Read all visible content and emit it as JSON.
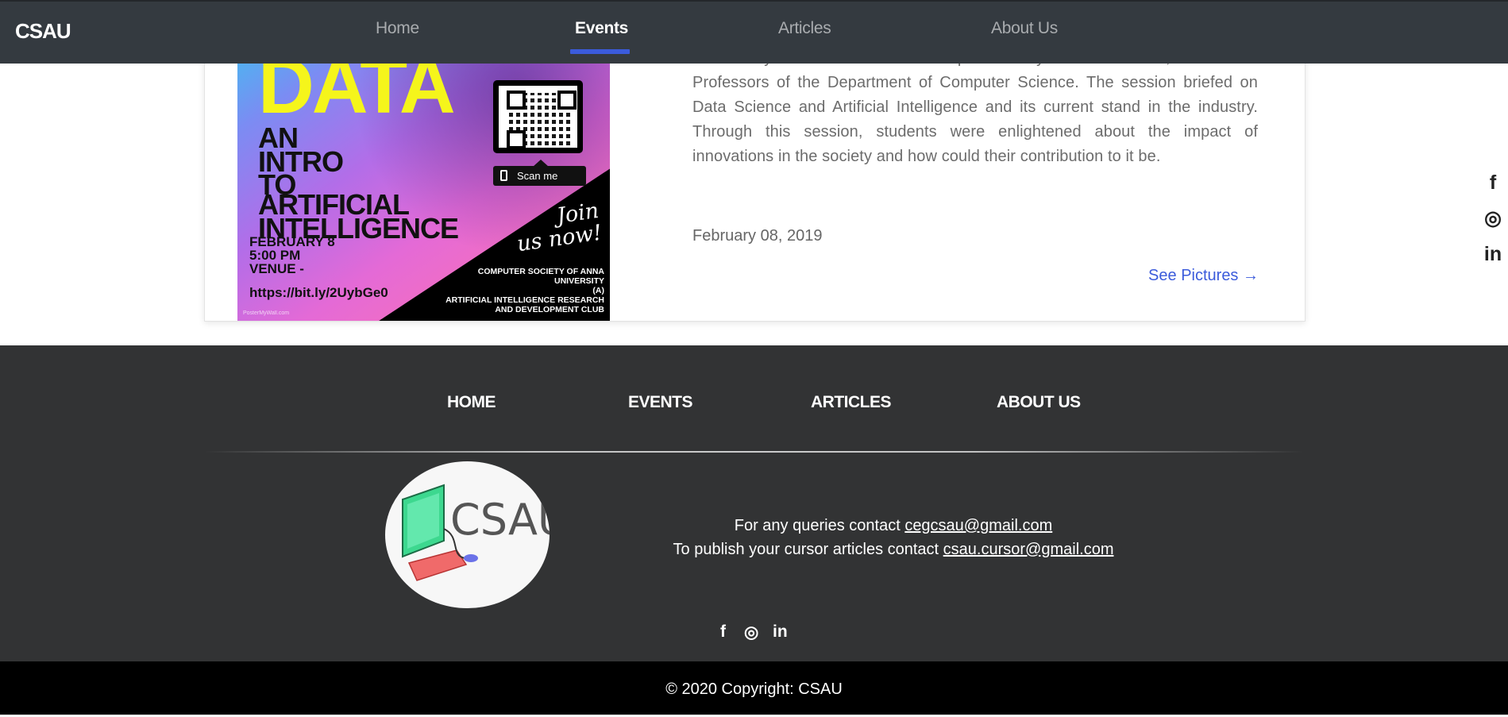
{
  "nav": {
    "brand": "CSAU",
    "links": [
      {
        "label": "Home",
        "active": false
      },
      {
        "label": "Events",
        "active": true
      },
      {
        "label": "Articles",
        "active": false
      },
      {
        "label": "About Us",
        "active": false
      }
    ],
    "accent_color": "#3b5bdb"
  },
  "event": {
    "poster": {
      "headline": "DATA",
      "intro_line1": "AN",
      "intro_line2": "INTRO",
      "intro_line3": "TO",
      "ai_line1": "ARTIFICIAL",
      "ai_line2": "INTELLIGENCE",
      "date_line": "FEBRUARY 8",
      "time_line": "5:00 PM",
      "venue_line": "VENUE -",
      "url": "https://bit.ly/2UybGe0",
      "scan_label": "Scan me",
      "join_line1": "Join",
      "join_line2": "us now!",
      "org_line1": "COMPUTER SOCIETY OF ANNA",
      "org_line2": "UNIVERSITY",
      "org_line3": "(A)",
      "org_line4": "ARTIFICIAL INTELLIGENCE RESEARCH",
      "org_line5": "AND DEVELOPMENT CLUB",
      "footer_mark": "PosterMyWall.com"
    },
    "description": "session by the name “Hello Data” presided by Dr R Baskaran, one of the Professors of the Department of Computer Science. The session briefed on Data Science and Artificial Intelligence and its current stand in the industry. Through this session, students were enlightened about the impact of innovations in the society and how could their contribution to it be.",
    "date": "February 08, 2019",
    "link_label": "See Pictures →"
  },
  "floating_social": [
    {
      "icon": "facebook-icon",
      "glyph": "f"
    },
    {
      "icon": "instagram-icon",
      "glyph": "◎"
    },
    {
      "icon": "linkedin-icon",
      "glyph": "in"
    }
  ],
  "footer": {
    "links": [
      "HOME",
      "EVENTS",
      "ARTICLES",
      "ABOUT US"
    ],
    "logo_text": "CSAU",
    "contact_line1_prefix": "For any queries contact ",
    "contact_line1_email": "cegcsau@gmail.com",
    "contact_line2_prefix": "To publish your cursor articles contact ",
    "contact_line2_email": "csau.cursor@gmail.com",
    "social": [
      {
        "icon": "facebook-icon",
        "glyph": "f"
      },
      {
        "icon": "instagram-icon",
        "glyph": "◎"
      },
      {
        "icon": "linkedin-icon",
        "glyph": "in"
      }
    ],
    "copyright": "© 2020 Copyright: CSAU"
  }
}
